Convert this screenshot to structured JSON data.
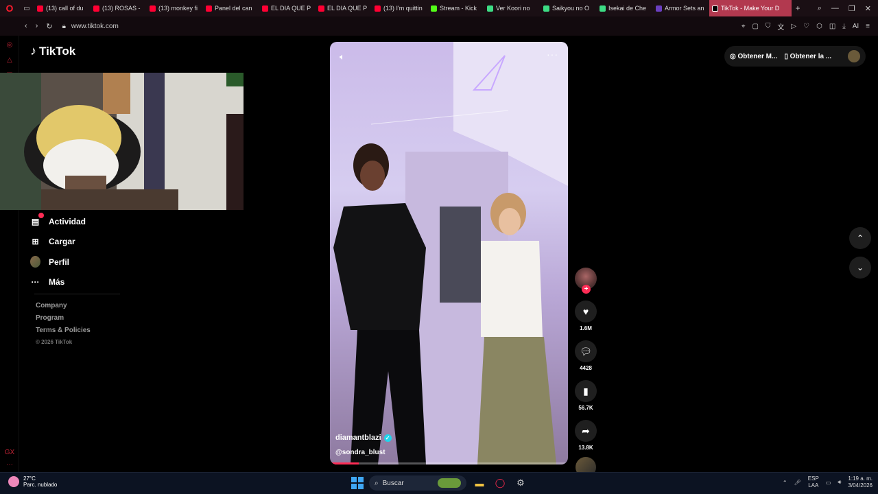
{
  "browser": {
    "tabs": [
      {
        "title": "(13) call of du",
        "color": "#ff0033"
      },
      {
        "title": "(13) ROSAS -",
        "color": "#ff0033"
      },
      {
        "title": "(13) monkey fi",
        "color": "#ff0033"
      },
      {
        "title": "Panel del can",
        "color": "#ff0033"
      },
      {
        "title": "EL DIA QUE P",
        "color": "#ff0033"
      },
      {
        "title": "EL DIA QUE P",
        "color": "#ff0033"
      },
      {
        "title": "(13) I'm quittin",
        "color": "#ff0033"
      },
      {
        "title": "Stream - Kick",
        "color": "#53fc18"
      },
      {
        "title": "Ver Koori no",
        "color": "#3ddc84"
      },
      {
        "title": "Saikyou no O",
        "color": "#3ddc84"
      },
      {
        "title": "Isekai de Che",
        "color": "#3ddc84"
      },
      {
        "title": "Armor Sets an",
        "color": "#6a3fc0"
      }
    ],
    "active_tab": "TikTok - Make Your D",
    "url": "www.tiktok.com",
    "ai_label": "AI"
  },
  "tiktok": {
    "logo": "TikTok",
    "menu": {
      "activity": "Actividad",
      "upload": "Cargar",
      "profile": "Perfil",
      "more": "Más"
    },
    "footer": {
      "company": "Company",
      "program": "Program",
      "terms": "Terms & Policies",
      "copyright": "© 2026 TikTok"
    },
    "top_right": {
      "get_coins": "Obtener M...",
      "get_app": "Obtener la ..."
    },
    "video": {
      "author": "diamantblazi",
      "sound": "@sondra_blust",
      "progress_pct": 12
    },
    "actions": {
      "likes": "1.6M",
      "comments": "4428",
      "saves": "56.7K",
      "shares": "13.8K"
    }
  },
  "taskbar": {
    "temp": "27°C",
    "weather": "Parc. nublado",
    "search": "Buscar",
    "lang1": "ESP",
    "lang2": "LAA",
    "time": "1:19 a. m.",
    "date": "3/04/2026"
  }
}
